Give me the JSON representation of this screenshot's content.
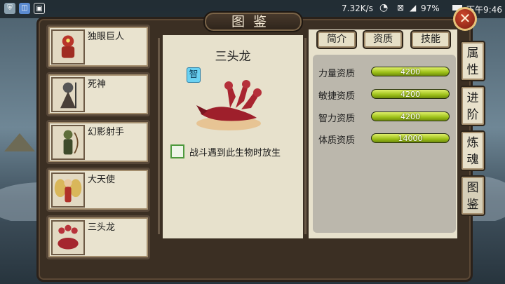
{
  "status_bar": {
    "net_speed": "7.32K/s",
    "battery": "97%",
    "time": "下午9:46",
    "left_icons": [
      "shield-app-icon",
      "notification-app-icon",
      "image-app-icon"
    ]
  },
  "dialog": {
    "title": "图鉴",
    "close_label": "✕"
  },
  "creature_list": [
    {
      "name": "独眼巨人",
      "icon": "cyclops-portrait"
    },
    {
      "name": "死神",
      "icon": "reaper-portrait"
    },
    {
      "name": "幻影射手",
      "icon": "phantom-archer-portrait"
    },
    {
      "name": "大天使",
      "icon": "archangel-portrait"
    },
    {
      "name": "三头龙",
      "icon": "hydra-portrait"
    }
  ],
  "detail": {
    "name": "三头龙",
    "type_badge": "智",
    "release_checkbox_label": "战斗遇到此生物时放生",
    "release_checked": false
  },
  "tabs": [
    "简介",
    "资质",
    "技能"
  ],
  "stats": [
    {
      "label": "力量资质",
      "value": "4200",
      "fill": 1.0
    },
    {
      "label": "敏捷资质",
      "value": "4200",
      "fill": 1.0
    },
    {
      "label": "智力资质",
      "value": "4200",
      "fill": 1.0
    },
    {
      "label": "体质资质",
      "value": "14000",
      "fill": 1.0
    }
  ],
  "side_tabs": [
    "属\n性",
    "进\n阶",
    "炼\n魂",
    "图\n鉴"
  ],
  "colors": {
    "panel_bg": "#e7e1cc",
    "stat_fill": "#9cbf18",
    "checkbox_border": "#4e9a3e",
    "close_button": "#b8321b"
  }
}
